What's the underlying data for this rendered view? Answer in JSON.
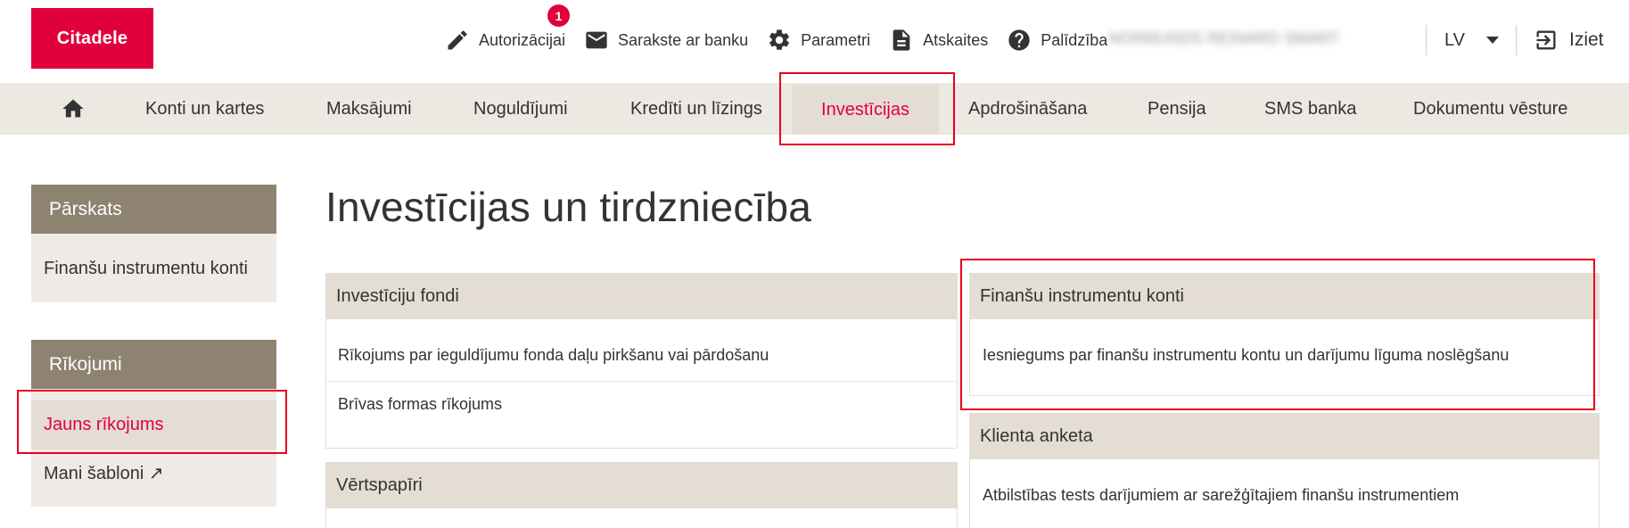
{
  "brand": {
    "logo_text": "Citadele",
    "accent_color": "#e0003c"
  },
  "header": {
    "links": [
      {
        "label": "Autorizācijai",
        "icon": "pencil-icon",
        "badge": "1"
      },
      {
        "label": "Sarakste ar banku",
        "icon": "envelope-icon"
      },
      {
        "label": "Parametri",
        "icon": "gear-icon"
      },
      {
        "label": "Atskaites",
        "icon": "document-icon"
      },
      {
        "label": "Palīdzība",
        "icon": "help-icon"
      }
    ],
    "user_name": "NORMUNDS REINARD SMART",
    "language": "LV",
    "logout_label": "Iziet"
  },
  "mainnav": {
    "items": [
      {
        "label": "",
        "icon": "home-icon"
      },
      {
        "label": "Konti un kartes"
      },
      {
        "label": "Maksājumi"
      },
      {
        "label": "Noguldījumi"
      },
      {
        "label": "Kredīti un līzings"
      },
      {
        "label": "Investīcijas",
        "active": true
      },
      {
        "label": "Apdrošināšana"
      },
      {
        "label": "Pensija"
      },
      {
        "label": "SMS banka"
      },
      {
        "label": "Dokumentu vēsture"
      }
    ]
  },
  "sidebar": {
    "sections": [
      {
        "title": "Pārskats",
        "items": [
          {
            "label": "Finanšu instrumentu konti"
          }
        ]
      },
      {
        "title": "Rīkojumi",
        "items": [
          {
            "label": "Jauns rīkojums",
            "active": true
          },
          {
            "label": "Mani šabloni ↗"
          }
        ]
      }
    ]
  },
  "main": {
    "title": "Investīcijas un tirdzniecība",
    "cards": [
      {
        "title": "Investīciju fondi",
        "links": [
          "Rīkojums par ieguldījumu fonda daļu pirkšanu vai pārdošanu",
          "Brīvas formas rīkojums"
        ]
      },
      {
        "title": "Vērtspapīri",
        "links": []
      },
      {
        "title": "Finanšu instrumentu konti",
        "links": [
          "Iesniegums par finanšu instrumentu kontu un darījumu līguma noslēgšanu"
        ]
      },
      {
        "title": "Klienta anketa",
        "links": [
          "Atbilstības tests darījumiem ar sarežģītajiem finanšu instrumentiem"
        ]
      }
    ]
  }
}
